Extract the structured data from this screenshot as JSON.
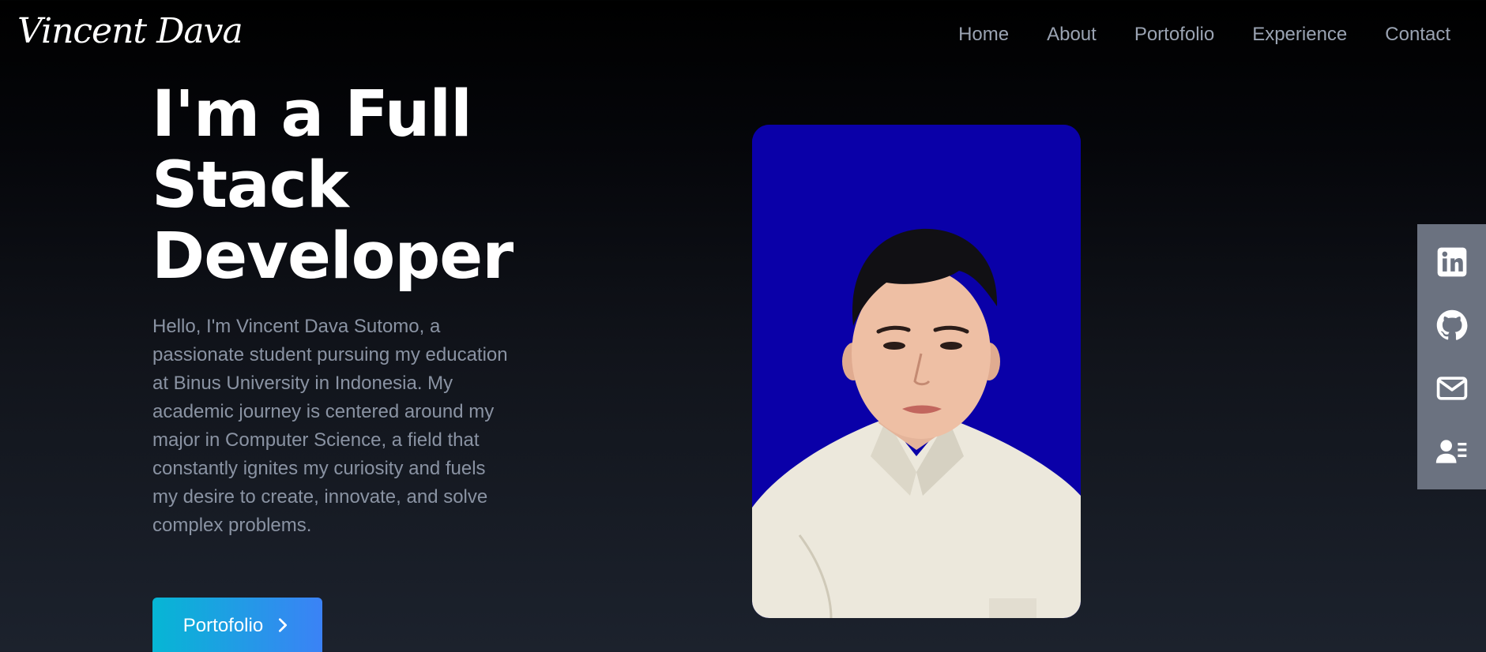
{
  "brand": {
    "logo_text": "Vincent Dava"
  },
  "nav": {
    "items": [
      {
        "label": "Home"
      },
      {
        "label": "About"
      },
      {
        "label": "Portofolio"
      },
      {
        "label": "Experience"
      },
      {
        "label": "Contact"
      }
    ]
  },
  "hero": {
    "title": "I'm a Full Stack Developer",
    "description": "Hello, I'm Vincent Dava Sutomo, a passionate student pursuing my education at Binus University in Indonesia. My academic journey is centered around my major in Computer Science, a field that constantly ignites my curiosity and fuels my desire to create, innovate, and solve complex problems.",
    "cta_label": "Portofolio",
    "cta_icon": "chevron-right-icon"
  },
  "profile_photo": {
    "background_color": "#0a00a8"
  },
  "social": {
    "background_color": "#6b7280",
    "icons": [
      "linkedin-icon",
      "github-icon",
      "mail-icon",
      "resume-icon"
    ]
  },
  "colors": {
    "button_gradient_start": "#06b6d4",
    "button_gradient_end": "#3b82f6",
    "nav_text": "#9aa3b2",
    "body_text": "#8a93a3"
  }
}
